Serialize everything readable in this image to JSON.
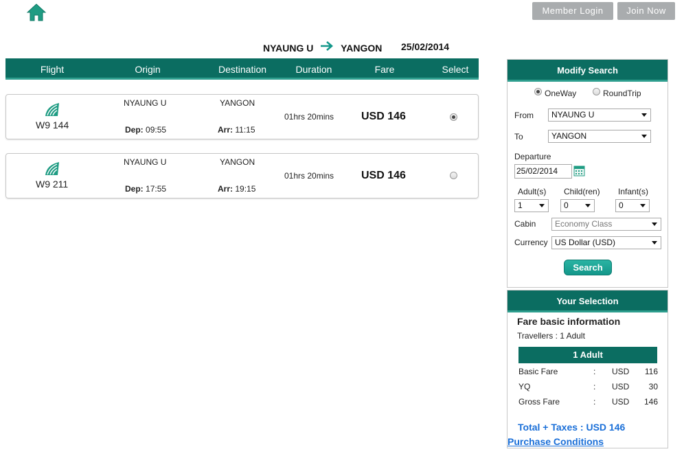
{
  "header": {
    "member_login": "Member Login",
    "join_now": "Join Now"
  },
  "route": {
    "origin": "NYAUNG U",
    "destination": "YANGON",
    "date": "25/02/2014"
  },
  "results_header": {
    "flight": "Flight",
    "origin": "Origin",
    "destination": "Destination",
    "duration": "Duration",
    "fare": "Fare",
    "select": "Select"
  },
  "flights": [
    {
      "flight_no": "W9 144",
      "origin": "NYAUNG U",
      "destination": "YANGON",
      "dep_label": "Dep:",
      "dep_time": "09:55",
      "arr_label": "Arr:",
      "arr_time": "11:15",
      "duration": "01hrs 20mins",
      "fare": "USD 146",
      "selected": true
    },
    {
      "flight_no": "W9 211",
      "origin": "NYAUNG U",
      "destination": "YANGON",
      "dep_label": "Dep:",
      "dep_time": "17:55",
      "arr_label": "Arr:",
      "arr_time": "19:15",
      "duration": "01hrs 20mins",
      "fare": "USD 146",
      "selected": false
    }
  ],
  "modify_search": {
    "title": "Modify Search",
    "oneway_label": "OneWay",
    "roundtrip_label": "RoundTrip",
    "trip_type": "OneWay",
    "from_label": "From",
    "from_value": "NYAUNG U",
    "to_label": "To",
    "to_value": "YANGON",
    "departure_label": "Departure",
    "departure_value": "25/02/2014",
    "adults_label": "Adult(s)",
    "adults_value": "1",
    "children_label": "Child(ren)",
    "children_value": "0",
    "infants_label": "Infant(s)",
    "infants_value": "0",
    "cabin_label": "Cabin",
    "cabin_value": "Economy Class",
    "currency_label": "Currency",
    "currency_value": "US Dollar (USD)",
    "search_button": "Search"
  },
  "your_selection": {
    "title": "Your Selection",
    "fare_info_title": "Fare basic information",
    "travellers": "Travellers : 1 Adult",
    "adult_header": "1 Adult",
    "rows": [
      {
        "label": "Basic Fare",
        "sep": ":",
        "currency": "USD",
        "amount": "116"
      },
      {
        "label": "YQ",
        "sep": ":",
        "currency": "USD",
        "amount": "30"
      },
      {
        "label": "Gross Fare",
        "sep": ":",
        "currency": "USD",
        "amount": "146"
      }
    ],
    "total": "Total + Taxes : USD 146",
    "purchase_conditions": "Purchase Conditions"
  },
  "colors": {
    "brand_dark": "#0b6d61",
    "brand_accent": "#2e9e8e",
    "link_blue": "#1a6fd8",
    "button_grey": "#a9acae"
  }
}
